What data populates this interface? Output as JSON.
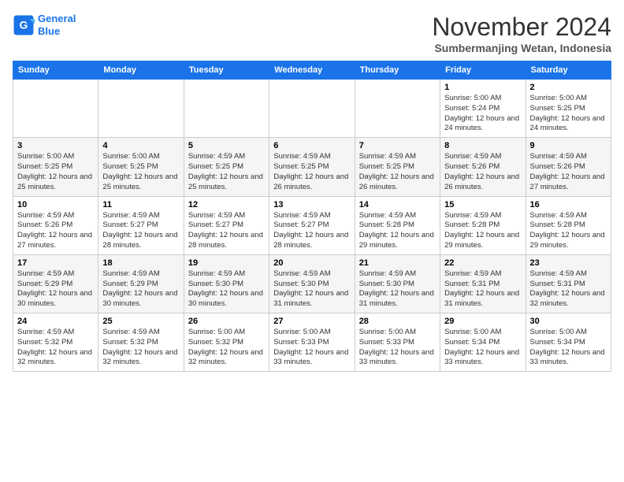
{
  "logo": {
    "line1": "General",
    "line2": "Blue"
  },
  "title": "November 2024",
  "location": "Sumbermanjing Wetan, Indonesia",
  "days_of_week": [
    "Sunday",
    "Monday",
    "Tuesday",
    "Wednesday",
    "Thursday",
    "Friday",
    "Saturday"
  ],
  "weeks": [
    [
      {
        "day": "",
        "info": ""
      },
      {
        "day": "",
        "info": ""
      },
      {
        "day": "",
        "info": ""
      },
      {
        "day": "",
        "info": ""
      },
      {
        "day": "",
        "info": ""
      },
      {
        "day": "1",
        "info": "Sunrise: 5:00 AM\nSunset: 5:24 PM\nDaylight: 12 hours and 24 minutes."
      },
      {
        "day": "2",
        "info": "Sunrise: 5:00 AM\nSunset: 5:25 PM\nDaylight: 12 hours and 24 minutes."
      }
    ],
    [
      {
        "day": "3",
        "info": "Sunrise: 5:00 AM\nSunset: 5:25 PM\nDaylight: 12 hours and 25 minutes."
      },
      {
        "day": "4",
        "info": "Sunrise: 5:00 AM\nSunset: 5:25 PM\nDaylight: 12 hours and 25 minutes."
      },
      {
        "day": "5",
        "info": "Sunrise: 4:59 AM\nSunset: 5:25 PM\nDaylight: 12 hours and 25 minutes."
      },
      {
        "day": "6",
        "info": "Sunrise: 4:59 AM\nSunset: 5:25 PM\nDaylight: 12 hours and 26 minutes."
      },
      {
        "day": "7",
        "info": "Sunrise: 4:59 AM\nSunset: 5:25 PM\nDaylight: 12 hours and 26 minutes."
      },
      {
        "day": "8",
        "info": "Sunrise: 4:59 AM\nSunset: 5:26 PM\nDaylight: 12 hours and 26 minutes."
      },
      {
        "day": "9",
        "info": "Sunrise: 4:59 AM\nSunset: 5:26 PM\nDaylight: 12 hours and 27 minutes."
      }
    ],
    [
      {
        "day": "10",
        "info": "Sunrise: 4:59 AM\nSunset: 5:26 PM\nDaylight: 12 hours and 27 minutes."
      },
      {
        "day": "11",
        "info": "Sunrise: 4:59 AM\nSunset: 5:27 PM\nDaylight: 12 hours and 28 minutes."
      },
      {
        "day": "12",
        "info": "Sunrise: 4:59 AM\nSunset: 5:27 PM\nDaylight: 12 hours and 28 minutes."
      },
      {
        "day": "13",
        "info": "Sunrise: 4:59 AM\nSunset: 5:27 PM\nDaylight: 12 hours and 28 minutes."
      },
      {
        "day": "14",
        "info": "Sunrise: 4:59 AM\nSunset: 5:28 PM\nDaylight: 12 hours and 29 minutes."
      },
      {
        "day": "15",
        "info": "Sunrise: 4:59 AM\nSunset: 5:28 PM\nDaylight: 12 hours and 29 minutes."
      },
      {
        "day": "16",
        "info": "Sunrise: 4:59 AM\nSunset: 5:28 PM\nDaylight: 12 hours and 29 minutes."
      }
    ],
    [
      {
        "day": "17",
        "info": "Sunrise: 4:59 AM\nSunset: 5:29 PM\nDaylight: 12 hours and 30 minutes."
      },
      {
        "day": "18",
        "info": "Sunrise: 4:59 AM\nSunset: 5:29 PM\nDaylight: 12 hours and 30 minutes."
      },
      {
        "day": "19",
        "info": "Sunrise: 4:59 AM\nSunset: 5:30 PM\nDaylight: 12 hours and 30 minutes."
      },
      {
        "day": "20",
        "info": "Sunrise: 4:59 AM\nSunset: 5:30 PM\nDaylight: 12 hours and 31 minutes."
      },
      {
        "day": "21",
        "info": "Sunrise: 4:59 AM\nSunset: 5:30 PM\nDaylight: 12 hours and 31 minutes."
      },
      {
        "day": "22",
        "info": "Sunrise: 4:59 AM\nSunset: 5:31 PM\nDaylight: 12 hours and 31 minutes."
      },
      {
        "day": "23",
        "info": "Sunrise: 4:59 AM\nSunset: 5:31 PM\nDaylight: 12 hours and 32 minutes."
      }
    ],
    [
      {
        "day": "24",
        "info": "Sunrise: 4:59 AM\nSunset: 5:32 PM\nDaylight: 12 hours and 32 minutes."
      },
      {
        "day": "25",
        "info": "Sunrise: 4:59 AM\nSunset: 5:32 PM\nDaylight: 12 hours and 32 minutes."
      },
      {
        "day": "26",
        "info": "Sunrise: 5:00 AM\nSunset: 5:32 PM\nDaylight: 12 hours and 32 minutes."
      },
      {
        "day": "27",
        "info": "Sunrise: 5:00 AM\nSunset: 5:33 PM\nDaylight: 12 hours and 33 minutes."
      },
      {
        "day": "28",
        "info": "Sunrise: 5:00 AM\nSunset: 5:33 PM\nDaylight: 12 hours and 33 minutes."
      },
      {
        "day": "29",
        "info": "Sunrise: 5:00 AM\nSunset: 5:34 PM\nDaylight: 12 hours and 33 minutes."
      },
      {
        "day": "30",
        "info": "Sunrise: 5:00 AM\nSunset: 5:34 PM\nDaylight: 12 hours and 33 minutes."
      }
    ]
  ]
}
